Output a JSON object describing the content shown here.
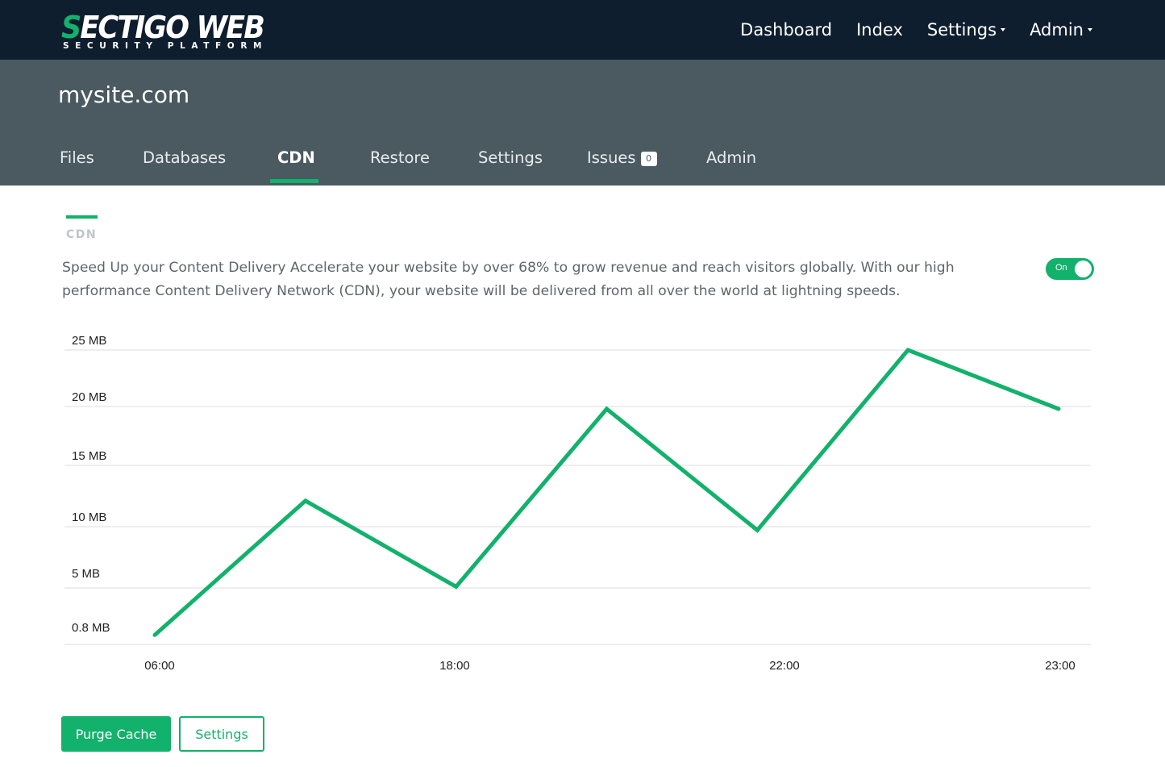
{
  "brand": {
    "logo_s": "S",
    "logo_main": "ECTIGO WEB",
    "logo_sub": "SECURITY PLATFORM",
    "accent_color": "#12b16c",
    "nav_bg": "#0f1e2e",
    "site_bar_bg": "#4b5961"
  },
  "topnav": {
    "items": [
      {
        "label": "Dashboard",
        "dropdown": false
      },
      {
        "label": "Index",
        "dropdown": false
      },
      {
        "label": "Settings",
        "dropdown": true
      },
      {
        "label": "Admin",
        "dropdown": true
      }
    ]
  },
  "site": {
    "title": "mysite.com"
  },
  "tabs": [
    {
      "label": "Files"
    },
    {
      "label": "Databases"
    },
    {
      "label": "CDN",
      "active": true
    },
    {
      "label": "Restore"
    },
    {
      "label": "Settings"
    },
    {
      "label": "Issues",
      "badge": "0"
    },
    {
      "label": "Admin"
    }
  ],
  "content": {
    "section_label": "CDN",
    "description": "Speed Up your Content Delivery Accelerate your website by over 68% to grow revenue and reach visitors globally. With our high performance Content Delivery Network (CDN), your website will be delivered from all over the world at lightning speeds.",
    "toggle": {
      "label": "On",
      "state": true
    }
  },
  "chart_data": {
    "type": "line",
    "y_tick_labels": [
      "25 MB",
      "20 MB",
      "15 MB",
      "10 MB",
      "5 MB",
      "0.8 MB"
    ],
    "x_tick_labels": [
      "06:00",
      "18:00",
      "22:00",
      "23:00"
    ],
    "series": [
      {
        "values": [
          0.8,
          12.2,
          4.9,
          20.0,
          9.7,
          25.0,
          20.0
        ],
        "color": "#12b16c"
      }
    ],
    "ylim": [
      0,
      25
    ],
    "grid": true
  },
  "actions": {
    "purge_label": "Purge Cache",
    "settings_label": "Settings"
  }
}
